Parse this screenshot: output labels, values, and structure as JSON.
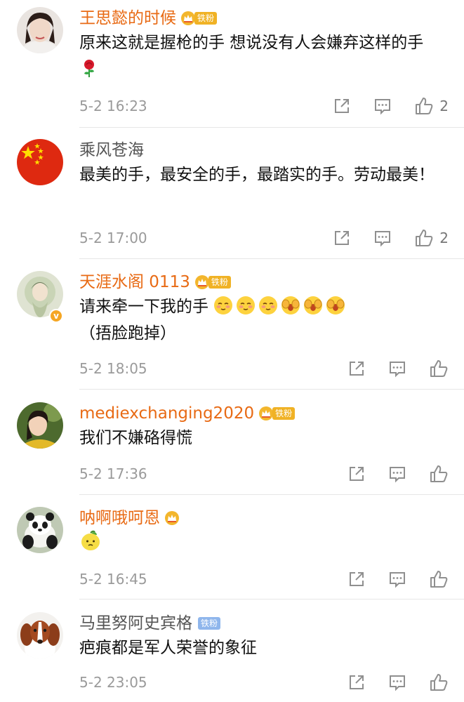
{
  "colors": {
    "orange_name": "#e86a14",
    "gray_name": "#555555",
    "gold_tag": "#f0b225",
    "blue_tag": "#8fb6ec",
    "meta": "#9a9a9a"
  },
  "comments": [
    {
      "user": "王思懿的时候",
      "badge": "铁粉",
      "text": "原来这就是握枪的手 想说没有人会嫌弃这样的手",
      "emoji": [
        "rose"
      ],
      "time": "5-2 16:23",
      "likes": "2"
    },
    {
      "user": "乘风苍海",
      "text": "最美的手，最安全的手，最踏实的手。劳动最美！",
      "time": "5-2 17:00",
      "likes": "2"
    },
    {
      "user": "天涯水阁 0113",
      "badge": "铁粉",
      "verified": "v",
      "text_before": "请来牵一下我的手",
      "emoji": [
        "blush",
        "blush",
        "blush",
        "shy",
        "shy",
        "shy"
      ],
      "text_after": "（捂脸跑掉）",
      "time": "5-2 18:05"
    },
    {
      "user": "mediexchanging2020",
      "badge": "铁粉",
      "text": "我们不嫌硌得慌",
      "time": "5-2 17:36"
    },
    {
      "user": "呐啊哦呵恩",
      "emoji": [
        "lemon"
      ],
      "time": "5-2 16:45"
    },
    {
      "user": "马里努阿史宾格",
      "badge": "铁粉",
      "text": "疤痕都是军人荣誉的象征",
      "time": "5-2 23:05"
    }
  ]
}
